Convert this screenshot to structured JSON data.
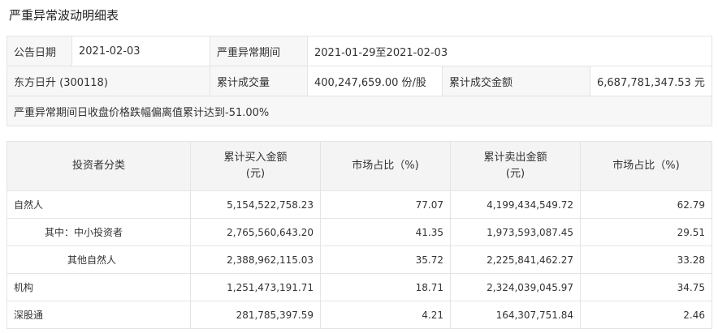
{
  "page_title": "严重异常波动明细表",
  "summary": {
    "announce_date_label": "公告日期",
    "announce_date_value": "2021-02-03",
    "period_label": "严重异常期间",
    "period_value": "2021-01-29至2021-02-03",
    "stock_name": "东方日升 (300118)",
    "volume_label": "累计成交量",
    "volume_value": "400,247,659.00 份/股",
    "amount_label": "累计成交金额",
    "amount_value": "6,687,781,347.53 元",
    "note": "严重异常期间日收盘价格跌幅偏离值累计达到-51.00%"
  },
  "investor_table": {
    "headers": {
      "category": "投资者分类",
      "buy_amount_line1": "累计买入金额",
      "buy_amount_line2": "(元)",
      "buy_share": "市场占比（%)",
      "sell_amount_line1": "累计卖出金额",
      "sell_amount_line2": "(元)",
      "sell_share": "市场占比（%)"
    },
    "rows": [
      {
        "category": "自然人",
        "buy": "5,154,522,758.23",
        "buy_pct": "77.07",
        "sell": "4,199,434,549.72",
        "sell_pct": "62.79"
      },
      {
        "category": "其中：中小投资者",
        "buy": "2,765,560,643.20",
        "buy_pct": "41.35",
        "sell": "1,973,593,087.45",
        "sell_pct": "29.51"
      },
      {
        "category": "其他自然人",
        "buy": "2,388,962,115.03",
        "buy_pct": "35.72",
        "sell": "2,225,841,462.27",
        "sell_pct": "33.28"
      },
      {
        "category": "机构",
        "buy": "1,251,473,191.71",
        "buy_pct": "18.71",
        "sell": "2,324,039,045.97",
        "sell_pct": "34.75"
      },
      {
        "category": "深股通",
        "buy": "281,785,397.59",
        "buy_pct": "4.21",
        "sell": "164,307,751.84",
        "sell_pct": "2.46"
      }
    ]
  }
}
